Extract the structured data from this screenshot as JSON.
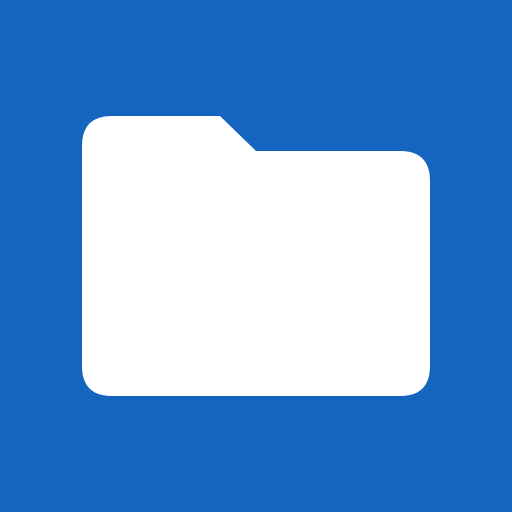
{
  "icon": {
    "name": "folder-icon",
    "background_color": "#1565C0",
    "glyph_color": "#FFFFFF"
  }
}
